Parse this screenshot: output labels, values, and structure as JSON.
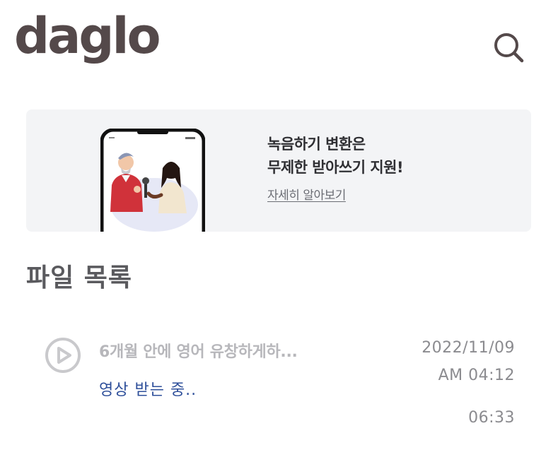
{
  "header": {
    "logo_text": "daglo",
    "search_icon": "search-icon"
  },
  "banner": {
    "line1": "녹음하기 변환은",
    "line2": "무제한 받아쓰기 지원!",
    "link_label": "자세히 알아보기"
  },
  "file_list": {
    "title": "파일 목록",
    "items": [
      {
        "name": "6개월 안에 영어 유창하게하...",
        "status": "영상 받는 중..",
        "date": "2022/11/09",
        "time": "AM 04:12",
        "duration": "06:33",
        "icon": "play-circle-icon"
      }
    ]
  },
  "colors": {
    "logo": "#54494a",
    "banner_bg": "#f3f4f6",
    "status_blue": "#2e4f9a",
    "muted_gray": "#b7b7bb"
  }
}
